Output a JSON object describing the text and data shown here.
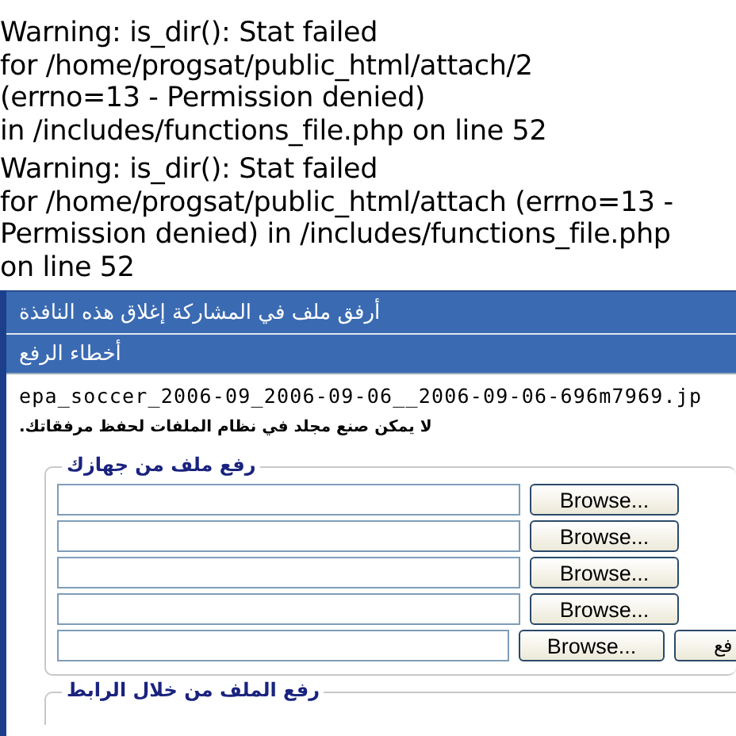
{
  "warnings": [
    {
      "lines": [
        "Warning: is_dir(): Stat failed",
        "for /home/progsat/public_html/attach/2",
        "(errno=13 - Permission denied)",
        "in /includes/functions_file.php on line 52"
      ]
    },
    {
      "lines": [
        "Warning: is_dir(): Stat failed",
        "for /home/progsat/public_html/attach (errno=13 -",
        "Permission denied) in /includes/functions_file.php",
        "on line 52"
      ]
    }
  ],
  "window": {
    "title": "أرفق ملف في المشاركة إغلاق هذه النافذة",
    "section_title": "أخطاء الرفع",
    "filename": "epa_soccer_2006-09_2006-09-06__2006-09-06-696m7969.jp",
    "error_message": "لا يمكن صنع مجلد في نظام الملفات لحفظ مرفقاتك."
  },
  "upload_group": {
    "legend": "رفع ملف من جهازك",
    "rows": [
      {
        "button": "Browse..."
      },
      {
        "button": "Browse..."
      },
      {
        "button": "Browse..."
      },
      {
        "button": "Browse..."
      },
      {
        "button": "Browse...",
        "submit": "فع"
      }
    ]
  },
  "url_group": {
    "legend": "رفع الملف من خلال الرابط"
  }
}
